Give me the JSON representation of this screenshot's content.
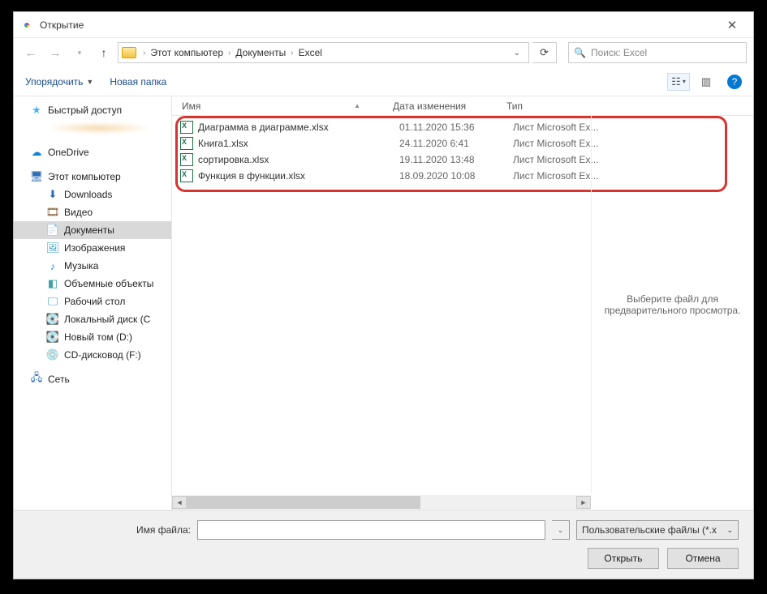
{
  "title": "Открытие",
  "breadcrumb": {
    "root": "",
    "items": [
      "Этот компьютер",
      "Документы",
      "Excel"
    ]
  },
  "search": {
    "placeholder": "Поиск: Excel"
  },
  "toolbar": {
    "organize": "Упорядочить",
    "newfolder": "Новая папка"
  },
  "sidebar": {
    "quickaccess": "Быстрый доступ",
    "onedrive": "OneDrive",
    "thispc": "Этот компьютер",
    "downloads": "Downloads",
    "video": "Видео",
    "documents": "Документы",
    "pictures": "Изображения",
    "music": "Музыка",
    "objects3d": "Объемные объекты",
    "desktop": "Рабочий стол",
    "localdisk": "Локальный диск (C",
    "newvol": "Новый том (D:)",
    "cddrive": "CD-дисковод (F:)",
    "network": "Сеть"
  },
  "columns": {
    "name": "Имя",
    "date": "Дата изменения",
    "type": "Тип"
  },
  "files": [
    {
      "name": "Диаграмма в диаграмме.xlsx",
      "date": "01.11.2020 15:36",
      "type": "Лист Microsoft Ex..."
    },
    {
      "name": "Книга1.xlsx",
      "date": "24.11.2020 6:41",
      "type": "Лист Microsoft Ex..."
    },
    {
      "name": "сортировка.xlsx",
      "date": "19.11.2020 13:48",
      "type": "Лист Microsoft Ex..."
    },
    {
      "name": "Функция в функции.xlsx",
      "date": "18.09.2020 10:08",
      "type": "Лист Microsoft Ex..."
    }
  ],
  "preview": {
    "text": "Выберите файл для предварительного просмотра."
  },
  "footer": {
    "filename_label": "Имя файла:",
    "filetype": "Пользовательские файлы (*.x",
    "open": "Открыть",
    "cancel": "Отмена"
  }
}
